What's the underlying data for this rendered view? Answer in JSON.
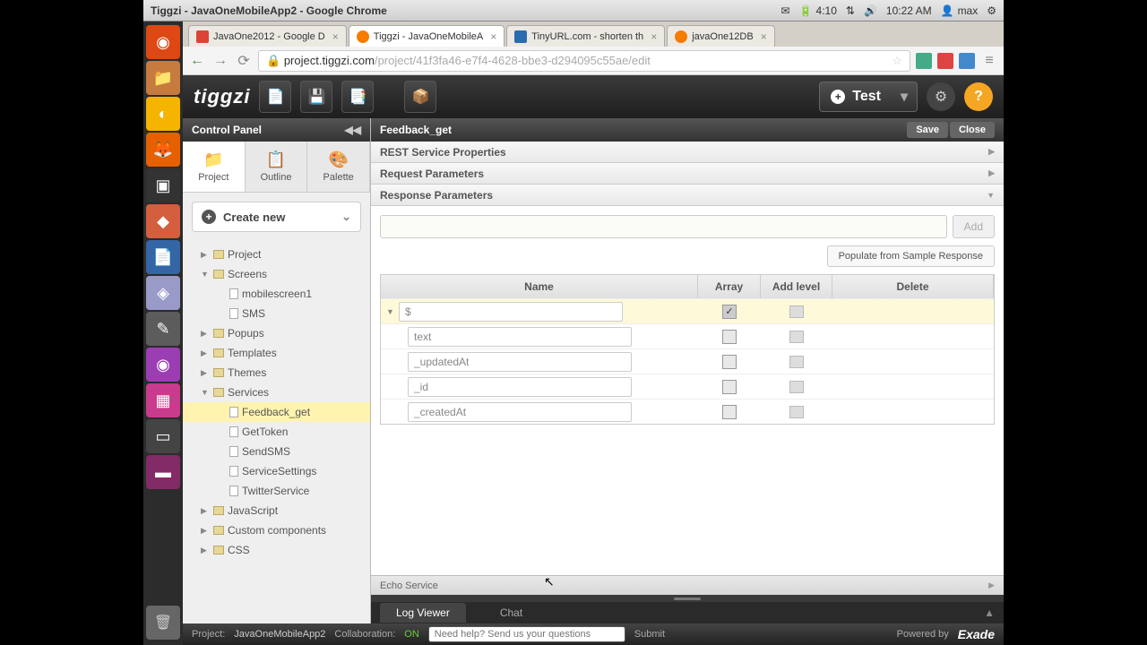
{
  "menubar": {
    "title": "Tiggzi - JavaOneMobileApp2 - Google Chrome",
    "battery": "4:10",
    "time": "10:22 AM",
    "user": "max"
  },
  "tabs": [
    {
      "label": "JavaOne2012 - Google D",
      "fav": "fav-g"
    },
    {
      "label": "Tiggzi - JavaOneMobileA",
      "fav": "fav-t",
      "active": true
    },
    {
      "label": "TinyURL.com - shorten th",
      "fav": "fav-u"
    },
    {
      "label": "javaOne12DB",
      "fav": "fav-t"
    }
  ],
  "url": {
    "host": "project.tiggzi.com",
    "path": "/project/41f3fa46-e7f4-4628-bbe3-d294095c55ae/edit"
  },
  "appbar": {
    "logo": "tiggzi",
    "test": "Test"
  },
  "control_panel": {
    "title": "Control Panel",
    "tabs": [
      {
        "label": "Project",
        "icon": "📁"
      },
      {
        "label": "Outline",
        "icon": "📋"
      },
      {
        "label": "Palette",
        "icon": "🎨"
      }
    ],
    "create_label": "Create new"
  },
  "tree": [
    {
      "label": "Project",
      "type": "folder",
      "depth": 1,
      "arr": "▶"
    },
    {
      "label": "Screens",
      "type": "folder",
      "depth": 1,
      "arr": "▼"
    },
    {
      "label": "mobilescreen1",
      "type": "file",
      "depth": 2
    },
    {
      "label": "SMS",
      "type": "file",
      "depth": 2
    },
    {
      "label": "Popups",
      "type": "folder",
      "depth": 1,
      "arr": "▶"
    },
    {
      "label": "Templates",
      "type": "folder",
      "depth": 1,
      "arr": "▶"
    },
    {
      "label": "Themes",
      "type": "folder",
      "depth": 1,
      "arr": "▶"
    },
    {
      "label": "Services",
      "type": "folder",
      "depth": 1,
      "arr": "▼"
    },
    {
      "label": "Feedback_get",
      "type": "file",
      "depth": 2,
      "sel": true
    },
    {
      "label": "GetToken",
      "type": "file",
      "depth": 2
    },
    {
      "label": "SendSMS",
      "type": "file",
      "depth": 2
    },
    {
      "label": "ServiceSettings",
      "type": "file",
      "depth": 2
    },
    {
      "label": "TwitterService",
      "type": "file",
      "depth": 2
    },
    {
      "label": "JavaScript",
      "type": "folder",
      "depth": 1,
      "arr": "▶"
    },
    {
      "label": "Custom components",
      "type": "folder",
      "depth": 1,
      "arr": "▶"
    },
    {
      "label": "CSS",
      "type": "folder",
      "depth": 1,
      "arr": "▶"
    }
  ],
  "editor": {
    "title": "Feedback_get",
    "save": "Save",
    "close": "Close",
    "sections": {
      "rest": "REST Service Properties",
      "req": "Request Parameters",
      "resp": "Response Parameters"
    },
    "add": "Add",
    "populate": "Populate from Sample Response",
    "columns": {
      "name": "Name",
      "array": "Array",
      "addlevel": "Add level",
      "delete": "Delete"
    },
    "rows": [
      {
        "name": "$",
        "array": true,
        "root": true
      },
      {
        "name": "text"
      },
      {
        "name": "_updatedAt"
      },
      {
        "name": "_id"
      },
      {
        "name": "_createdAt"
      }
    ],
    "echo": "Echo Service"
  },
  "bottom": {
    "tabs": [
      "Log Viewer",
      "Chat"
    ],
    "active": 0
  },
  "status": {
    "project_lbl": "Project:",
    "project": "JavaOneMobileApp2",
    "collab_lbl": "Collaboration:",
    "collab": "ON",
    "help_ph": "Need help? Send us your questions",
    "submit": "Submit",
    "powered": "Powered by",
    "brand": "Exade"
  }
}
